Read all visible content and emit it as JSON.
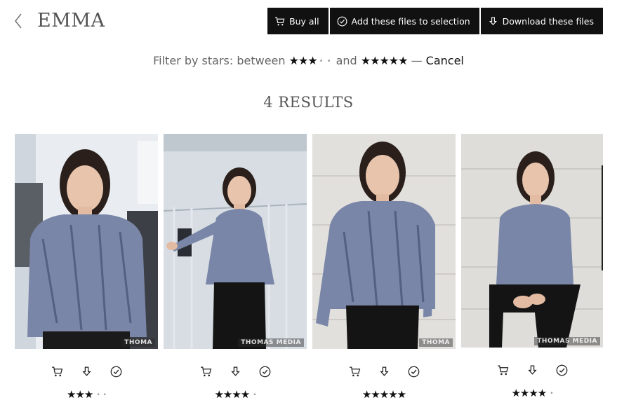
{
  "header": {
    "title": "EMMA",
    "buttons": {
      "buy_all": "Buy all",
      "add_selection": "Add these files to selection",
      "download": "Download these files"
    }
  },
  "filter": {
    "prefix": "Filter by stars: between",
    "from_stars": 3,
    "and": "and",
    "to_stars": 5,
    "dash": "—",
    "cancel": "Cancel"
  },
  "results": {
    "label": "4 RESULTS"
  },
  "photos": [
    {
      "watermark": "THOMA",
      "stars": 3,
      "max": 5
    },
    {
      "watermark": "THOMAS MEDIA",
      "stars": 4,
      "max": 5
    },
    {
      "watermark": "THOMA",
      "stars": 5,
      "max": 5
    },
    {
      "watermark": "THOMAS MEDIA",
      "stars": 4,
      "max": 5
    }
  ]
}
